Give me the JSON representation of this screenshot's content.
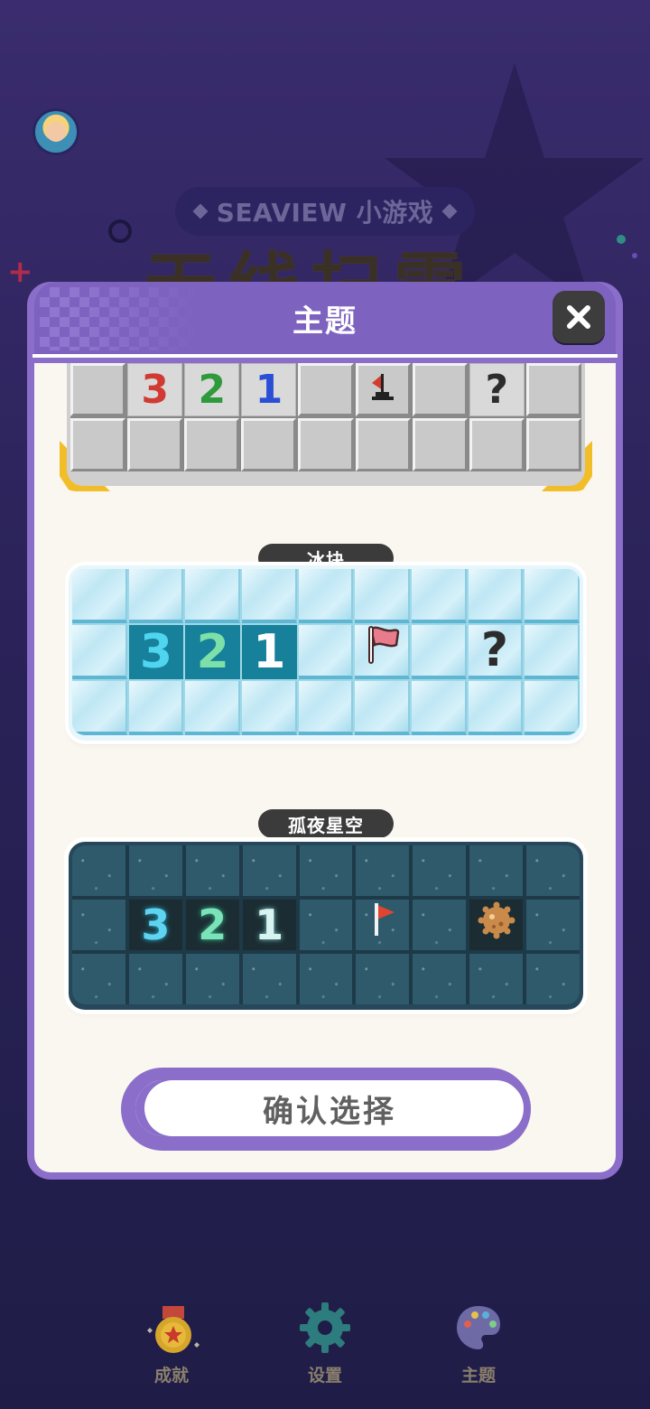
{
  "header": {
    "badge_text": "SEAVIEW 小游戏",
    "game_title": "无线扫雷"
  },
  "modal": {
    "title": "主题",
    "close_icon": "close-icon",
    "confirm_label": "确认选择"
  },
  "themes": [
    {
      "id": "classic",
      "name": "",
      "rows": [
        [
          "",
          "3",
          "2",
          "1",
          "",
          "flag",
          "",
          "?",
          ""
        ],
        [
          "",
          "",
          "",
          "",
          "",
          "",
          "",
          "",
          ""
        ]
      ],
      "number_colors": {
        "3": "#d03a32",
        "2": "#2f9a3c",
        "1": "#2a4fd6"
      }
    },
    {
      "id": "ice",
      "name": "冰块",
      "rows": [
        [
          "",
          "",
          "",
          "",
          "",
          "",
          "",
          "",
          ""
        ],
        [
          "",
          "3",
          "2",
          "1",
          "",
          "flag",
          "",
          "?",
          ""
        ],
        [
          "",
          "",
          "",
          "",
          "",
          "",
          "",
          "",
          ""
        ]
      ],
      "number_colors": {
        "3": "#4fd5ef",
        "2": "#7de0a8",
        "1": "#ffffff"
      }
    },
    {
      "id": "night",
      "name": "孤夜星空",
      "rows": [
        [
          "",
          "",
          "",
          "",
          "",
          "",
          "",
          "",
          ""
        ],
        [
          "",
          "3",
          "2",
          "1",
          "",
          "flag",
          "",
          "mine",
          ""
        ],
        [
          "",
          "",
          "",
          "",
          "",
          "",
          "",
          "",
          ""
        ]
      ]
    }
  ],
  "nav": {
    "items": [
      {
        "label": "成就",
        "icon": "medal-icon"
      },
      {
        "label": "设置",
        "icon": "gear-icon"
      },
      {
        "label": "主题",
        "icon": "palette-icon"
      }
    ]
  },
  "colors": {
    "modal_purple": "#8a6ec9",
    "panel_bg": "#faf7f0",
    "accent_yellow": "#f1be2a"
  }
}
